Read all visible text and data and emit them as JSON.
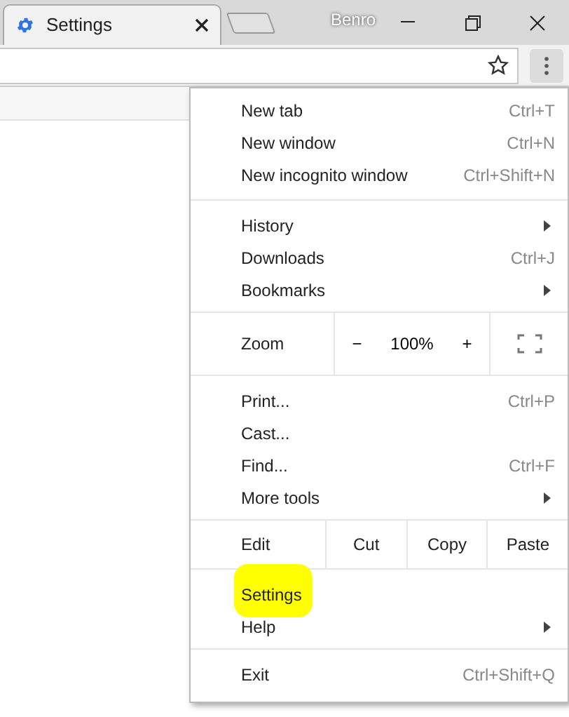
{
  "tabs": [
    {
      "title": "Settings",
      "selected": true
    }
  ],
  "profile": {
    "name": "Benro"
  },
  "menu": {
    "sections": [
      {
        "items": [
          {
            "kind": "item",
            "label": "New tab",
            "shortcut": "Ctrl+T"
          },
          {
            "kind": "item",
            "label": "New window",
            "shortcut": "Ctrl+N"
          },
          {
            "kind": "item",
            "label": "New incognito window",
            "shortcut": "Ctrl+Shift+N"
          }
        ]
      },
      {
        "items": [
          {
            "kind": "submenu",
            "label": "History"
          },
          {
            "kind": "item",
            "label": "Downloads",
            "shortcut": "Ctrl+J"
          },
          {
            "kind": "submenu",
            "label": "Bookmarks"
          }
        ]
      },
      {
        "items": [
          {
            "kind": "zoom",
            "label": "Zoom",
            "minus": "−",
            "value": "100%",
            "plus": "+"
          }
        ]
      },
      {
        "items": [
          {
            "kind": "item",
            "label": "Print...",
            "shortcut": "Ctrl+P"
          },
          {
            "kind": "item",
            "label": "Cast..."
          },
          {
            "kind": "item",
            "label": "Find...",
            "shortcut": "Ctrl+F"
          },
          {
            "kind": "submenu",
            "label": "More tools"
          }
        ]
      },
      {
        "items": [
          {
            "kind": "edit",
            "label": "Edit",
            "actions": [
              "Cut",
              "Copy",
              "Paste"
            ]
          }
        ]
      },
      {
        "items": [
          {
            "kind": "item",
            "label": "Settings",
            "highlighted": true
          },
          {
            "kind": "submenu",
            "label": "Help"
          }
        ]
      },
      {
        "items": [
          {
            "kind": "item",
            "label": "Exit",
            "shortcut": "Ctrl+Shift+Q"
          }
        ]
      }
    ]
  }
}
